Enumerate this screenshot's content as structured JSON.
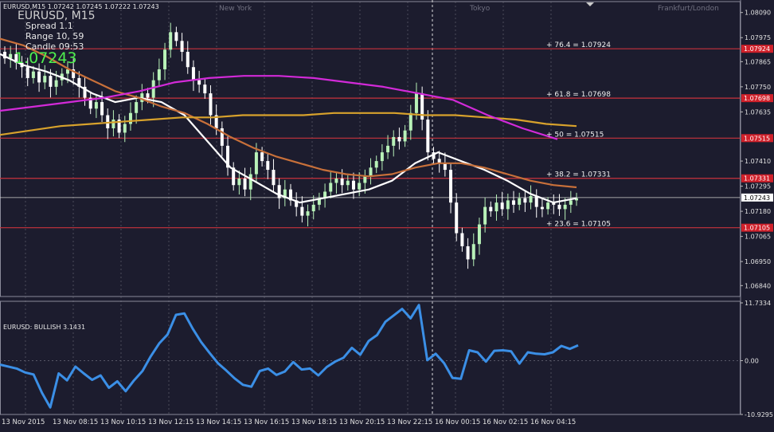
{
  "header": {
    "symbol_line": "EURUSD,M15 1.07242 1.07245 1.07222 1.07243",
    "title": "EURUSD, M15",
    "spread": "Spread  1.1",
    "range": "Range  10, 59",
    "candle": "Candle  09:53",
    "price": "1.07243"
  },
  "sessions": [
    "New York",
    "Tokyo",
    "Frankfurt/London"
  ],
  "indicator_label": "EURUSD: BULLISH  3.1431",
  "colors": {
    "background": "#1c1c2e",
    "grid": "#6a6a7a",
    "bull_candle": "#b8f2b8",
    "bear_candle": "#ffffff",
    "fib_line": "#c8323c",
    "ma_white": "#ffffff",
    "ma_orange": "#c8703a",
    "ma_yellow": "#d8a22c",
    "ma_magenta": "#d22ad8",
    "indicator": "#3b8fe6",
    "price_label_red": "#d0202a"
  },
  "chart_data": [
    {
      "type": "candlestick",
      "title": "EURUSD, M15",
      "y_ticks": [
        "1.08090",
        "1.07975",
        "1.07865",
        "1.07750",
        "1.07635",
        "1.07410",
        "1.07295",
        "1.07180",
        "1.07065",
        "1.06950",
        "1.06840"
      ],
      "ylim": [
        1.0679,
        1.0814
      ],
      "x_ticks": [
        "13 Nov 2015",
        "13 Nov 08:15",
        "13 Nov 10:15",
        "13 Nov 12:15",
        "13 Nov 14:15",
        "13 Nov 16:15",
        "13 Nov 18:15",
        "13 Nov 20:15",
        "13 Nov 22:15",
        "16 Nov 00:15",
        "16 Nov 02:15",
        "16 Nov 04:15"
      ],
      "current_price": "1.07243",
      "fibonacci_levels": [
        {
          "label": "+ 76.4  = 1.07924",
          "value": 1.07924
        },
        {
          "label": "+ 61.8  = 1.07698",
          "value": 1.07698
        },
        {
          "label": "+ 50  = 1.07515",
          "value": 1.07515
        },
        {
          "label": "+ 38.2  = 1.07331",
          "value": 1.07331
        },
        {
          "label": "+ 23.6  = 1.07105",
          "value": 1.07105
        }
      ],
      "closes": [
        1.0788,
        1.079,
        1.0786,
        1.0784,
        1.0779,
        1.0782,
        1.0777,
        1.078,
        1.0775,
        1.0778,
        1.0781,
        1.0783,
        1.0779,
        1.0775,
        1.077,
        1.0765,
        1.0768,
        1.0762,
        1.0756,
        1.076,
        1.0754,
        1.0758,
        1.0763,
        1.0768,
        1.0772,
        1.077,
        1.0778,
        1.0783,
        1.0792,
        1.08,
        1.0796,
        1.0791,
        1.0784,
        1.0778,
        1.0776,
        1.0772,
        1.0762,
        1.0756,
        1.0748,
        1.0738,
        1.073,
        1.0733,
        1.0728,
        1.0735,
        1.0745,
        1.0741,
        1.0737,
        1.073,
        1.0724,
        1.0728,
        1.0723,
        1.072,
        1.0716,
        1.0718,
        1.0721,
        1.0724,
        1.0727,
        1.0731,
        1.0733,
        1.073,
        1.0732,
        1.0728,
        1.0731,
        1.0734,
        1.0738,
        1.0741,
        1.0745,
        1.0748,
        1.0752,
        1.075,
        1.0755,
        1.0763,
        1.0772,
        1.076,
        1.0745,
        1.0742,
        1.074,
        1.0737,
        1.0722,
        1.0708,
        1.0702,
        1.0696,
        1.0703,
        1.0712,
        1.072,
        1.0718,
        1.0722,
        1.0719,
        1.0723,
        1.0721,
        1.0724,
        1.0722,
        1.0725,
        1.072,
        1.0719,
        1.0722,
        1.0721,
        1.0719,
        1.0721,
        1.0723,
        1.0724
      ],
      "series": [
        {
          "name": "",
          "color": "#ffffff",
          "values": [
            1.079,
            1.0785,
            1.0782,
            1.0778,
            1.0772,
            1.0768,
            1.077,
            1.0768,
            1.0762,
            1.075,
            1.0738,
            1.0732,
            1.0726,
            1.0722,
            1.0724,
            1.0726,
            1.0728,
            1.0732,
            1.074,
            1.0745,
            1.0741,
            1.0737,
            1.0732,
            1.0726,
            1.0722,
            1.0724
          ]
        },
        {
          "name": "",
          "color": "#c8703a",
          "values": [
            1.0797,
            1.0794,
            1.0789,
            1.0783,
            1.0778,
            1.0773,
            1.077,
            1.0766,
            1.0763,
            1.0758,
            1.0752,
            1.0747,
            1.0743,
            1.074,
            1.0737,
            1.0735,
            1.0734,
            1.0735,
            1.0738,
            1.074,
            1.074,
            1.0738,
            1.0735,
            1.0732,
            1.073,
            1.0729
          ]
        },
        {
          "name": "",
          "color": "#d8a22c",
          "values": [
            1.0753,
            1.0755,
            1.0757,
            1.0758,
            1.0759,
            1.076,
            1.0761,
            1.0761,
            1.0762,
            1.0762,
            1.0762,
            1.0763,
            1.0763,
            1.0763,
            1.0762,
            1.0762,
            1.0761,
            1.076,
            1.0758,
            1.0757
          ]
        },
        {
          "name": "",
          "color": "#d22ad8",
          "values": [
            1.0764,
            1.0766,
            1.0768,
            1.077,
            1.0773,
            1.0777,
            1.0779,
            1.078,
            1.078,
            1.0779,
            1.0777,
            1.0775,
            1.0772,
            1.0769,
            1.0762,
            1.0756,
            1.0751
          ]
        }
      ]
    },
    {
      "type": "line",
      "title": "EURUSD: BULLISH  3.1431",
      "y_ticks": [
        "11.7334",
        "0.00",
        "-10.9295"
      ],
      "ylim": [
        -10.9295,
        11.7334
      ],
      "values": [
        -0.8,
        -1.2,
        -1.6,
        -2.4,
        -2.8,
        -6.5,
        -9.5,
        -2.6,
        -4.0,
        -1.2,
        -2.6,
        -3.9,
        -3.0,
        -5.5,
        -4.2,
        -6.2,
        -4.0,
        -2.1,
        0.9,
        3.5,
        5.3,
        9.3,
        9.6,
        6.5,
        3.8,
        1.6,
        -0.5,
        -2.0,
        -3.6,
        -4.9,
        -5.3,
        -2.1,
        -1.6,
        -2.9,
        -2.2,
        -0.3,
        -1.8,
        -1.6,
        -3.0,
        -1.3,
        -0.2,
        0.6,
        2.6,
        1.2,
        4.0,
        5.2,
        7.9,
        9.2,
        10.5,
        8.6,
        11.3,
        0.1,
        1.4,
        -0.5,
        -3.5,
        -3.7,
        2.1,
        1.7,
        -0.2,
        2.0,
        2.1,
        1.9,
        -0.6,
        1.7,
        1.4,
        1.3,
        1.7,
        3.0,
        2.4,
        3.1
      ],
      "show_zero_line": true
    }
  ]
}
